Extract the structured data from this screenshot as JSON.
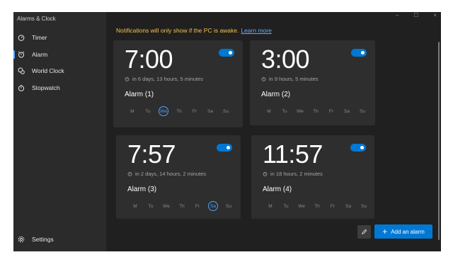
{
  "app": {
    "title": "Alarms & Clock"
  },
  "caption": {
    "minimize": "–",
    "maximize": "☐",
    "close": "×"
  },
  "sidebar": {
    "items": [
      {
        "label": "Timer",
        "icon": "timer-icon"
      },
      {
        "label": "Alarm",
        "icon": "alarm-icon",
        "selected": true
      },
      {
        "label": "World Clock",
        "icon": "world-clock-icon"
      },
      {
        "label": "Stopwatch",
        "icon": "stopwatch-icon"
      }
    ],
    "settings": {
      "label": "Settings",
      "icon": "gear-icon"
    }
  },
  "notice": {
    "text": "Notifications will only show if the PC is awake.",
    "link": "Learn more"
  },
  "alarms": [
    {
      "time": "7:00",
      "remaining": "in 6 days, 13 hours, 5 minutes",
      "name": "Alarm (1)",
      "enabled": true,
      "days": [
        "M",
        "Tu",
        "We",
        "Th",
        "Fr",
        "Sa",
        "Su"
      ],
      "active_day": "We"
    },
    {
      "time": "3:00",
      "remaining": "in 9 hours, 5 minutes",
      "name": "Alarm (2)",
      "enabled": true,
      "days": [
        "M",
        "Tu",
        "We",
        "Th",
        "Fr",
        "Sa",
        "Su"
      ],
      "active_day": ""
    },
    {
      "time": "7:57",
      "remaining": "in 2 days, 14 hours, 2 minutes",
      "name": "Alarm (3)",
      "enabled": true,
      "days": [
        "M",
        "Tu",
        "We",
        "Th",
        "Fr",
        "Sa",
        "Su"
      ],
      "active_day": "Sa"
    },
    {
      "time": "11:57",
      "remaining": "in 18 hours, 2 minutes",
      "name": "Alarm (4)",
      "enabled": true,
      "days": [
        "M",
        "Tu",
        "We",
        "Th",
        "Fr",
        "Sa",
        "Su"
      ],
      "active_day": ""
    }
  ],
  "actions": {
    "add_label": "Add an alarm",
    "edit_icon": "pencil-icon"
  },
  "colors": {
    "accent": "#0078d4",
    "notice": "#f3c24b",
    "background": "#202020",
    "card": "#2e2e2e"
  }
}
